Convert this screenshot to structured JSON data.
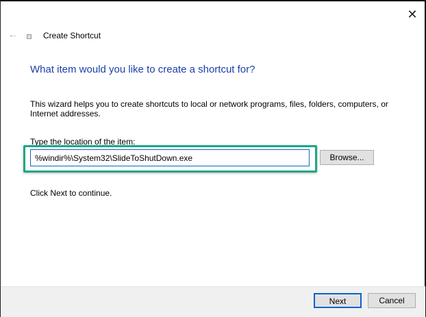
{
  "window": {
    "title": "Create Shortcut"
  },
  "heading": "What item would you like to create a shortcut for?",
  "description": "This wizard helps you to create shortcuts to local or network programs, files, folders, computers, or Internet addresses.",
  "location": {
    "label": "Type the location of the item:",
    "value": "%windir%\\System32\\SlideToShutDown.exe"
  },
  "buttons": {
    "browse": "Browse...",
    "next": "Next",
    "cancel": "Cancel"
  },
  "continue_text": "Click Next to continue.",
  "colors": {
    "accent": "#0a64c8",
    "heading": "#1a3fa8",
    "highlight": "#1aa885"
  }
}
